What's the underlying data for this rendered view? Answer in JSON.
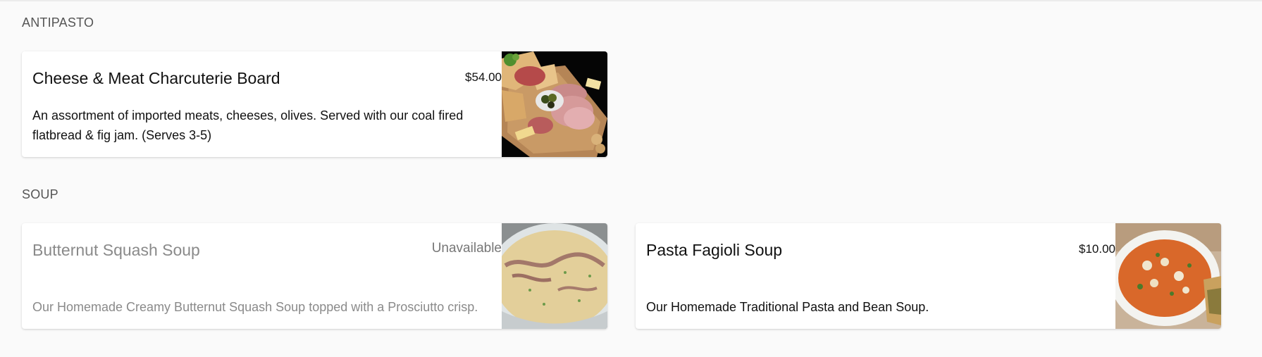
{
  "sections": [
    {
      "title": "ANTIPASTO",
      "items": [
        {
          "name": "Cheese & Meat Charcuterie Board",
          "price": "$54.00",
          "description": "An assortment of imported meats, cheeses, olives. Served with our coal fired flatbread & fig jam. (Serves 3-5)",
          "image": "charcuterie-board-photo"
        }
      ]
    },
    {
      "title": "SOUP",
      "items": [
        {
          "name": "Butternut Squash Soup",
          "price": "Unavailable",
          "description": "Our Homemade Creamy Butternut Squash Soup topped with a Prosciutto crisp.",
          "image": "butternut-squash-soup-photo",
          "available": false
        },
        {
          "name": "Pasta Fagioli Soup",
          "price": "$10.00",
          "description": "Our Homemade Traditional Pasta and Bean Soup.",
          "image": "pasta-fagioli-soup-photo"
        }
      ]
    }
  ]
}
